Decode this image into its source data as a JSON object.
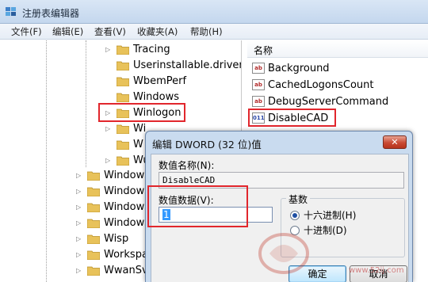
{
  "window": {
    "title": "注册表编辑器"
  },
  "menu": [
    {
      "label": "文件(F)"
    },
    {
      "label": "编辑(E)"
    },
    {
      "label": "查看(V)"
    },
    {
      "label": "收藏夹(A)"
    },
    {
      "label": "帮助(H)"
    }
  ],
  "tree": {
    "items": [
      {
        "label": "Tracing",
        "expander": "▷"
      },
      {
        "label": "Userinstallable.driver",
        "expander": ""
      },
      {
        "label": "WbemPerf",
        "expander": ""
      },
      {
        "label": "Windows",
        "expander": ""
      },
      {
        "label": "Winlogon",
        "expander": "▷"
      },
      {
        "label": "Wi",
        "expander": "▷"
      },
      {
        "label": "W",
        "expander": ""
      },
      {
        "label": "Wu",
        "expander": "▷"
      },
      {
        "label": "Windows",
        "expander": "▷"
      },
      {
        "label": "Windows",
        "expander": "▷"
      },
      {
        "label": "Windows",
        "expander": "▷"
      },
      {
        "label": "Windows",
        "expander": "▷"
      },
      {
        "label": "Wisp",
        "expander": "▷"
      },
      {
        "label": "Workspa",
        "expander": "▷"
      },
      {
        "label": "WwanSvc",
        "expander": "▷"
      }
    ]
  },
  "list": {
    "column_name": "名称",
    "rows": [
      {
        "label": "Background",
        "icon": "ab"
      },
      {
        "label": "CachedLogonsCount",
        "icon": "ab"
      },
      {
        "label": "DebugServerCommand",
        "icon": "ab"
      },
      {
        "label": "DisableCAD",
        "icon": "011"
      }
    ]
  },
  "dialog": {
    "title": "编辑 DWORD (32 位)值",
    "close_label": "✕",
    "name_label": "数值名称(N):",
    "name_value": "DisableCAD",
    "data_label": "数值数据(V):",
    "data_value": "1",
    "base_label": "基数",
    "radio_hex": "十六进制(H)",
    "radio_dec": "十进制(D)",
    "ok_label": "确定",
    "cancel_label": "取消"
  },
  "watermark": {
    "url": "www.52ij.com"
  }
}
